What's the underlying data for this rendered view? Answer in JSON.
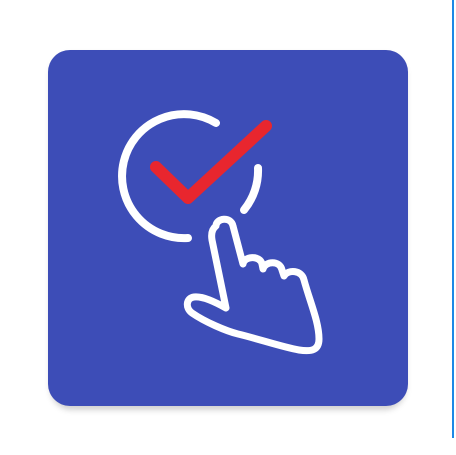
{
  "app_icon": {
    "name": "tap-to-check-app-icon",
    "background_color": "#3d4db7",
    "check_color": "#e8262e",
    "outline_color": "#ffffff"
  },
  "divider": {
    "color": "#1e88e5"
  }
}
